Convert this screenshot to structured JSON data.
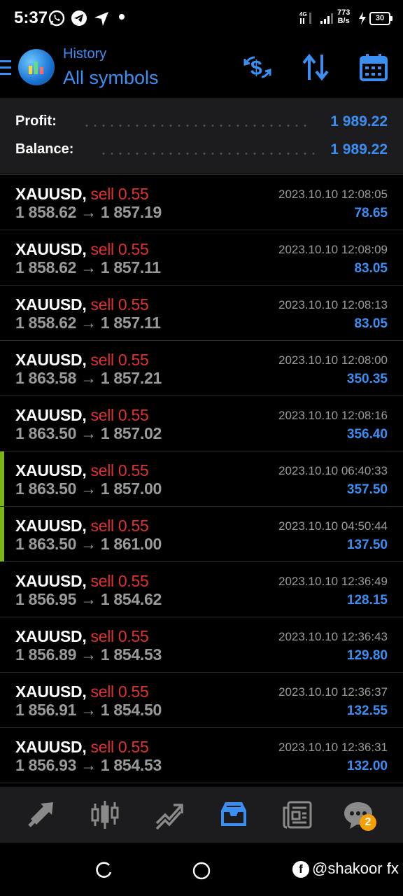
{
  "status_bar": {
    "time": "5:37",
    "net_speed_value": "773",
    "net_speed_unit": "B/s",
    "battery": "30",
    "icons": [
      "whatsapp-icon",
      "telegram-icon",
      "send-icon",
      "signal-icon",
      "charging-icon"
    ]
  },
  "header": {
    "title": "History",
    "subtitle": "All symbols",
    "icons": [
      "menu-icon",
      "app-logo",
      "deposit-icon",
      "sort-icon",
      "calendar-icon"
    ]
  },
  "summary": {
    "profit_label": "Profit:",
    "profit_value": "1 989.22",
    "balance_label": "Balance:",
    "balance_value": "1 989.22"
  },
  "arrow_glyph": "→",
  "trades": [
    {
      "symbol": "XAUUSD,",
      "side": "sell 0.55",
      "open": "1 858.62",
      "close": "1 857.19",
      "time": "2023.10.10 12:08:05",
      "profit": "78.65",
      "marked": false
    },
    {
      "symbol": "XAUUSD,",
      "side": "sell 0.55",
      "open": "1 858.62",
      "close": "1 857.11",
      "time": "2023.10.10 12:08:09",
      "profit": "83.05",
      "marked": false
    },
    {
      "symbol": "XAUUSD,",
      "side": "sell 0.55",
      "open": "1 858.62",
      "close": "1 857.11",
      "time": "2023.10.10 12:08:13",
      "profit": "83.05",
      "marked": false
    },
    {
      "symbol": "XAUUSD,",
      "side": "sell 0.55",
      "open": "1 863.58",
      "close": "1 857.21",
      "time": "2023.10.10 12:08:00",
      "profit": "350.35",
      "marked": false
    },
    {
      "symbol": "XAUUSD,",
      "side": "sell 0.55",
      "open": "1 863.50",
      "close": "1 857.02",
      "time": "2023.10.10 12:08:16",
      "profit": "356.40",
      "marked": false
    },
    {
      "symbol": "XAUUSD,",
      "side": "sell 0.55",
      "open": "1 863.50",
      "close": "1 857.00",
      "time": "2023.10.10 06:40:33",
      "profit": "357.50",
      "marked": true
    },
    {
      "symbol": "XAUUSD,",
      "side": "sell 0.55",
      "open": "1 863.50",
      "close": "1 861.00",
      "time": "2023.10.10 04:50:44",
      "profit": "137.50",
      "marked": true
    },
    {
      "symbol": "XAUUSD,",
      "side": "sell 0.55",
      "open": "1 856.95",
      "close": "1 854.62",
      "time": "2023.10.10 12:36:49",
      "profit": "128.15",
      "marked": false
    },
    {
      "symbol": "XAUUSD,",
      "side": "sell 0.55",
      "open": "1 856.89",
      "close": "1 854.53",
      "time": "2023.10.10 12:36:43",
      "profit": "129.80",
      "marked": false
    },
    {
      "symbol": "XAUUSD,",
      "side": "sell 0.55",
      "open": "1 856.91",
      "close": "1 854.50",
      "time": "2023.10.10 12:36:37",
      "profit": "132.55",
      "marked": false
    },
    {
      "symbol": "XAUUSD,",
      "side": "sell 0.55",
      "open": "1 856.93",
      "close": "1 854.53",
      "time": "2023.10.10 12:36:31",
      "profit": "132.00",
      "marked": false
    }
  ],
  "bottom_nav": {
    "items": [
      "quotes-icon",
      "chart-icon",
      "trade-icon",
      "history-icon",
      "news-icon",
      "chat-icon"
    ],
    "active": "history-icon",
    "chat_badge": "2"
  },
  "system_nav": {
    "icons": [
      "recent-apps-icon",
      "home-icon"
    ]
  },
  "watermark": {
    "text": "@shakoor fx",
    "icon": "facebook-icon"
  },
  "colors": {
    "accent": "#3b8ff3",
    "sell": "#e03131",
    "marker": "#7cb518",
    "badge": "#f59f00",
    "panel": "#1c1c1e"
  }
}
